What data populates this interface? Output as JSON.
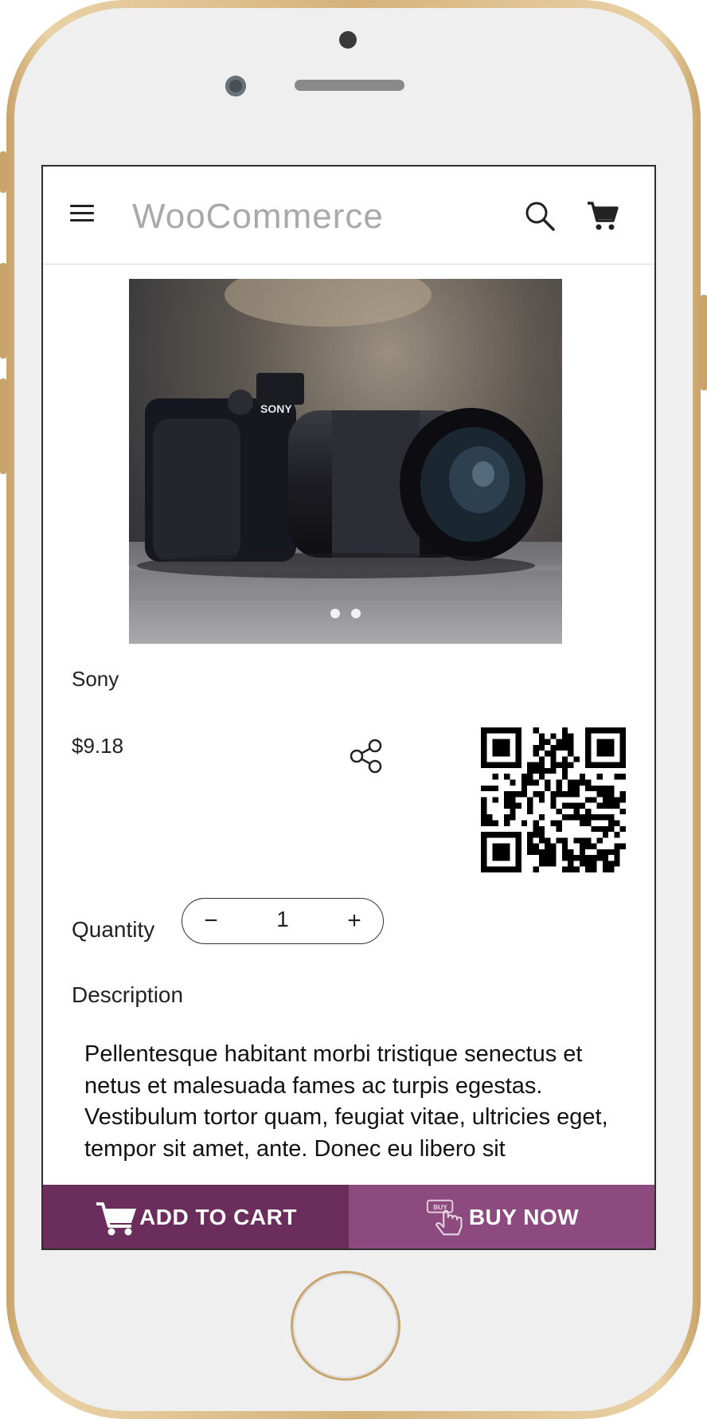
{
  "app": {
    "title": "WooCommerce"
  },
  "icons": {
    "menu": "hamburger-menu-icon",
    "search": "search-icon",
    "cart": "shopping-cart-icon",
    "share": "share-icon",
    "qr": "qr-code",
    "add_to_cart": "cart-add-icon",
    "buy_now": "buy-pointer-icon"
  },
  "product": {
    "image_description": "camera-photo",
    "carousel_dots": 2,
    "brand": "Sony",
    "price": "$9.18"
  },
  "quantity": {
    "label": "Quantity",
    "value": "1",
    "minus": "−",
    "plus": "+"
  },
  "description": {
    "label": "Description",
    "text": "Pellentesque habitant morbi tristique senectus et netus et malesuada fames ac turpis egestas. Vestibulum tortor quam, feugiat vitae, ultricies eget, tempor sit amet, ante. Donec eu libero sit"
  },
  "actions": {
    "add_to_cart": "ADD TO CART",
    "buy_now": "BUY NOW",
    "buy_icon_text": "BUY"
  },
  "colors": {
    "add_to_cart_bg": "#6a2d5c",
    "buy_now_bg": "#8c4a7e",
    "title_color": "#a9a9a9"
  }
}
